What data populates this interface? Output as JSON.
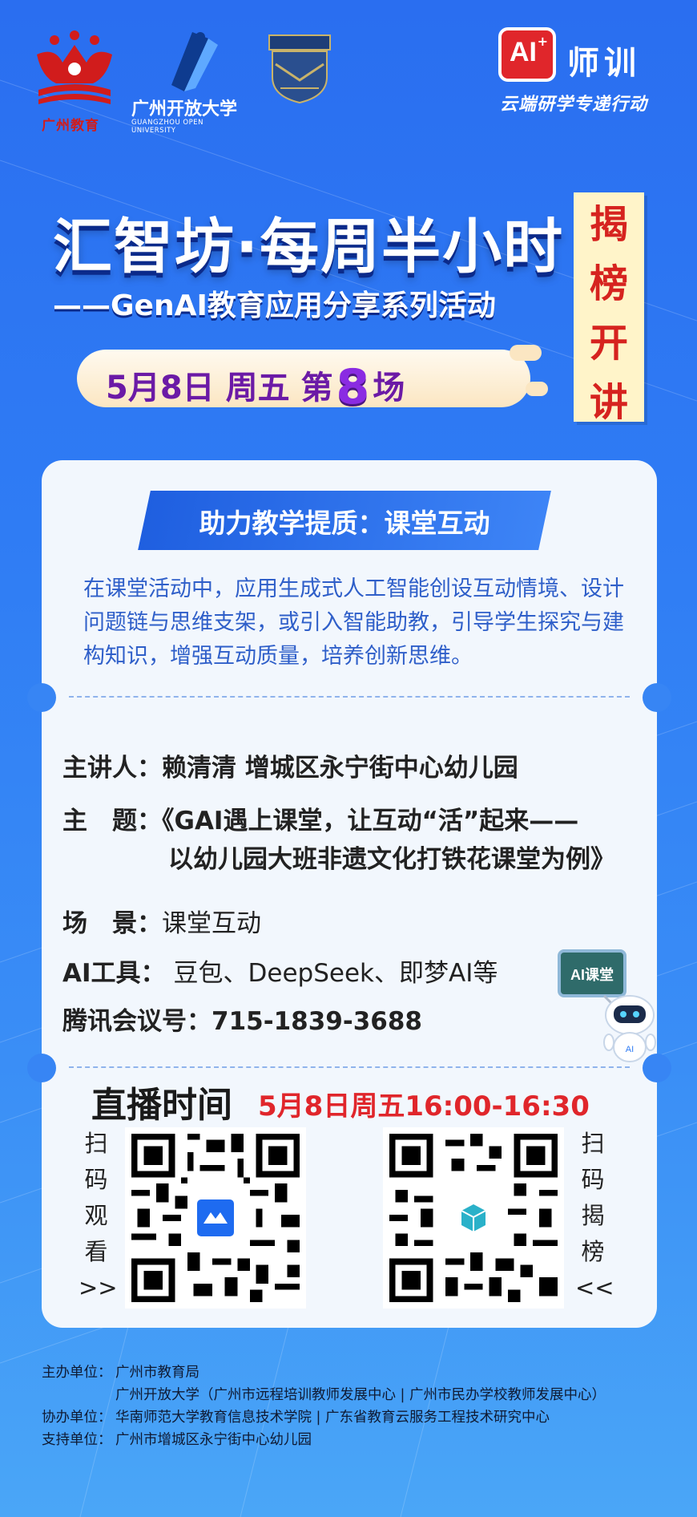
{
  "header": {
    "logo_edu_caption": "广州教育",
    "logo_gou_cn": "广州开放大学",
    "logo_gou_en": "GUANGZHOU OPEN UNIVERSITY",
    "ai_badge": "AI",
    "ai_badge_plus": "+",
    "brand_name": "师训",
    "brand_slogan": "云端研学专递行动"
  },
  "title": {
    "main": "汇智坊·每周半小时",
    "sub": "——GenAI教育应用分享系列活动",
    "badge_chars": [
      "揭",
      "榜",
      "开",
      "讲"
    ],
    "date_prefix": "5月8日 周五 第",
    "session_number": "8",
    "date_suffix": "场"
  },
  "card": {
    "topic_banner": "助力教学提质：课堂互动",
    "intro": "在课堂活动中，应用生成式人工智能创设互动情境、设计问题链与思维支架，或引入智能助教，引导学生探究与建构知识，增强互动质量，培养创新思维。",
    "speaker_key": "主讲人：",
    "speaker_val": "赖清清 增城区永宁街中心幼儿园",
    "topic_key": "主　题：",
    "topic_val_1": "《GAI遇上课堂，让互动“活”起来——",
    "topic_val_2": "以幼儿园大班非遗文化打铁花课堂为例》",
    "scene_key": "场　景：",
    "scene_val": "课堂互动",
    "tools_key": "AI工具：",
    "tools_val": "豆包、DeepSeek、即梦AI等",
    "meeting_key": "腾讯会议号：",
    "meeting_val": "715-1839-3688",
    "robot_board": "AI课堂",
    "live_label": "直播时间",
    "live_time": "5月8日周五16:00-16:30",
    "scan_watch": [
      "扫",
      "码",
      "观",
      "看",
      ">>"
    ],
    "scan_rank": [
      "扫",
      "码",
      "揭",
      "榜",
      "<<"
    ]
  },
  "footer": {
    "host_key": "主办单位：",
    "host_1": "广州市教育局",
    "host_2": "广州开放大学（广州市远程培训教师发展中心 | 广州市民办学校教师发展中心）",
    "co_key": "协办单位：",
    "co_val": "华南师范大学教育信息技术学院 | 广东省教育云服务工程技术研究中心",
    "support_key": "支持单位：",
    "support_val": "广州市增城区永宁街中心幼儿园"
  },
  "colors": {
    "background": "#2f7cf4",
    "title_shadow": "#0b2a8a",
    "badge_red": "#d6231f",
    "date_purple": "#6b1aa6",
    "intro_blue": "#2f5fc9",
    "live_time_red": "#e0262b"
  }
}
